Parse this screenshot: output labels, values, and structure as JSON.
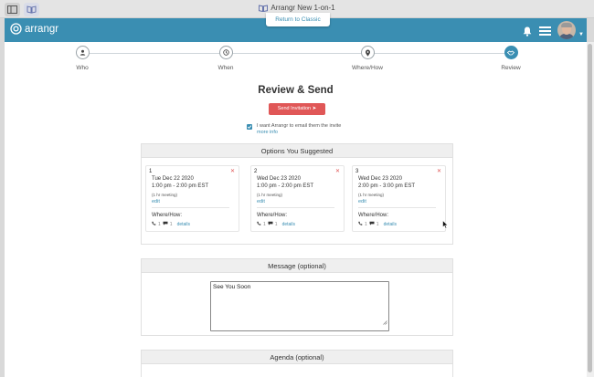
{
  "window": {
    "title": "Arrangr New 1-on-1"
  },
  "navbar": {
    "logo_text": "arrangr",
    "return_label": "Return to Classic"
  },
  "stepper": [
    {
      "label": "Who",
      "icon": "person-icon"
    },
    {
      "label": "When",
      "icon": "clock-icon"
    },
    {
      "label": "Where/How",
      "icon": "location-pin-icon"
    },
    {
      "label": "Review",
      "icon": "handshake-icon",
      "active": true
    }
  ],
  "page": {
    "title": "Review & Send",
    "send_label": "Send Invitation ➤",
    "email_checkbox_label": "I want Arrangr to email them the invite",
    "email_checked": true,
    "more_info": "more info"
  },
  "options": {
    "header": "Options You Suggested",
    "items": [
      {
        "num": "1",
        "date": "Tue Dec 22 2020",
        "time": "1:00 pm - 2:00 pm EST",
        "duration": "(1 hr meeting)",
        "edit": "edit",
        "where_label": "Where/How:",
        "phone_count": "1",
        "chat_count": "1",
        "details": "details"
      },
      {
        "num": "2",
        "date": "Wed Dec 23 2020",
        "time": "1:00 pm - 2:00 pm EST",
        "duration": "(1 hr meeting)",
        "edit": "edit",
        "where_label": "Where/How:",
        "phone_count": "1",
        "chat_count": "1",
        "details": "details"
      },
      {
        "num": "3",
        "date": "Wed Dec 23 2020",
        "time": "2:00 pm - 3:00 pm EST",
        "duration": "(1 hr meeting)",
        "edit": "edit",
        "where_label": "Where/How:",
        "phone_count": "1",
        "chat_count": "1",
        "details": "details"
      }
    ]
  },
  "message": {
    "header": "Message (optional)",
    "value": "See You Soon"
  },
  "agenda": {
    "header": "Agenda (optional)"
  },
  "colors": {
    "accent": "#3a8eb2",
    "danger": "#e05757"
  }
}
